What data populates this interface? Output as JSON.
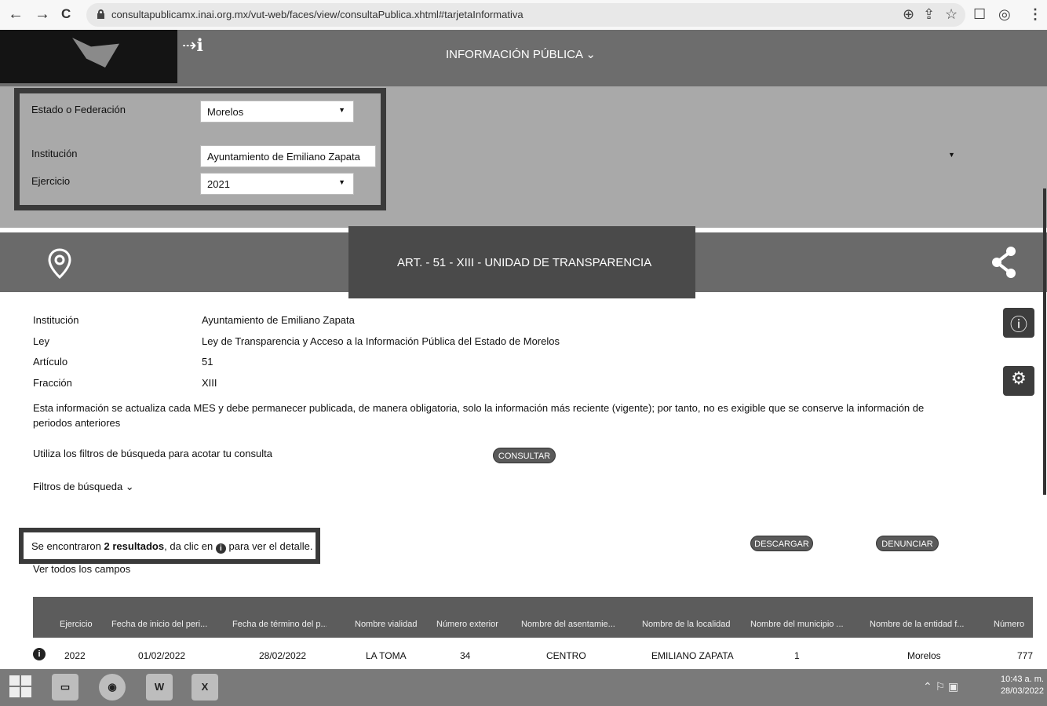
{
  "browser": {
    "back": "←",
    "forward": "→",
    "reload": "C",
    "url": "consultapublicamx.inai.org.mx/vut-web/faces/view/consultaPublica.xhtml#tarjetaInformativa",
    "zoom_icon": "zoom-icon",
    "share_icon": "share-page-icon",
    "bookmark_icon": "star-icon",
    "menu_icon": "kebab-menu-icon"
  },
  "header": {
    "info_glyph": "⇢ℹ",
    "menu_title": "INFORMACIÓN PÚBLICA ⌄"
  },
  "filters": {
    "estado_label": "Estado o Federación",
    "estado_value": "Morelos",
    "institucion_label": "Institución",
    "institucion_value": "Ayuntamiento de Emiliano Zapata",
    "ejercicio_label": "Ejercicio",
    "ejercicio_value": "2021"
  },
  "section": {
    "title": "ART. - 51 - XIII - UNIDAD DE TRANSPARENCIA"
  },
  "details": {
    "institucion_label": "Institución",
    "institucion_value": "Ayuntamiento de Emiliano Zapata",
    "ley_label": "Ley",
    "ley_value": "Ley de Transparencia y Acceso a la Información Pública del Estado de Morelos",
    "articulo_label": "Artículo",
    "articulo_value": "51",
    "fraccion_label": "Fracción",
    "fraccion_value": "XIII",
    "notice": "Esta información se actualiza cada MES y debe permanecer publicada, de manera obligatoria, solo la información más reciente (vigente); por tanto, no es exigible que se conserve la información de periodos anteriores",
    "hint": "Utiliza los filtros de búsqueda para acotar tu consulta",
    "consultar": "CONSULTAR",
    "filtros_toggle": "Filtros de búsqueda ⌄"
  },
  "results": {
    "prefix": "Se encontraron ",
    "count": "2 resultados",
    "middle": ", da clic en ",
    "suffix": " para ver el detalle.",
    "descargar": "DESCARGAR",
    "denunciar": "DENUNCIAR",
    "see_all": "Ver todos los campos"
  },
  "table": {
    "headers": [
      "Ejercicio",
      "Fecha de inicio del peri...",
      "Fecha de término del p...",
      "Nombre vialidad",
      "Número exterior",
      "Nombre del asentamie...",
      "Nombre de la localidad",
      "Nombre del municipio ...",
      "Nombre de la entidad f...",
      "Número"
    ],
    "rows": [
      [
        "2022",
        "01/02/2022",
        "28/02/2022",
        "LA TOMA",
        "34",
        "CENTRO",
        "EMILIANO ZAPATA",
        "1",
        "Morelos",
        "777"
      ]
    ]
  },
  "taskbar": {
    "word": "W",
    "excel": "X",
    "clock_time": "10:43 a. m.",
    "clock_date": "28/03/2022"
  }
}
